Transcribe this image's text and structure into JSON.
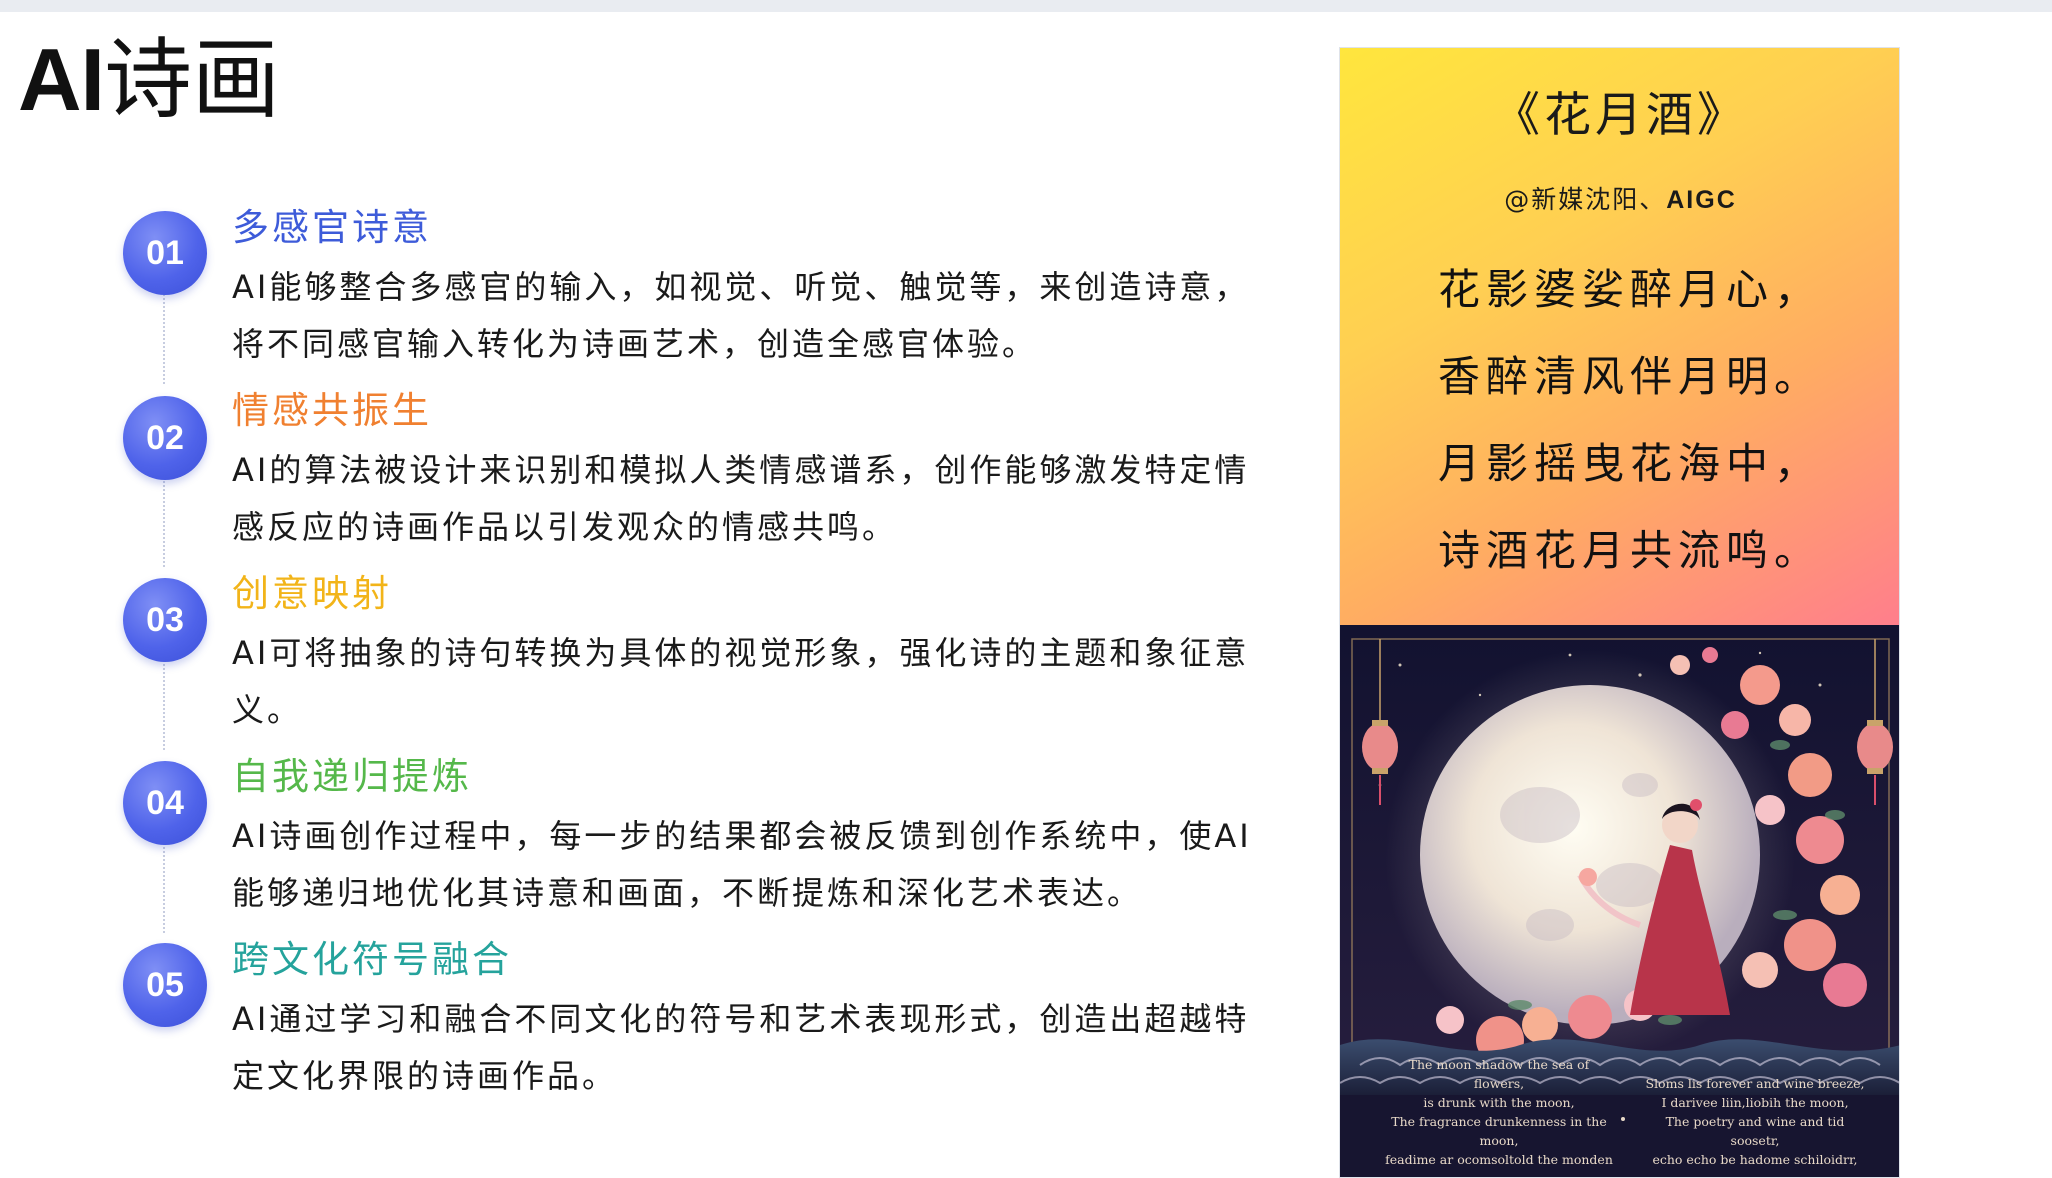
{
  "title": {
    "latin": "AI",
    "cjk": "诗画"
  },
  "colors": {
    "badge": "#4f63ea",
    "item_titles": [
      "#3d5bd9",
      "#f08030",
      "#f2b419",
      "#55b84a",
      "#25a39c"
    ],
    "poster_gradient": [
      "#ffe63d",
      "#ffac62",
      "#ff7e8c"
    ]
  },
  "items": [
    {
      "number": "01",
      "title": "多感官诗意",
      "body": "AI能够整合多感官的输入，如视觉、听觉、触觉等，来创造诗意，将不同感官输入转化为诗画艺术，创造全感官体验。"
    },
    {
      "number": "02",
      "title": "情感共振生",
      "body": "AI的算法被设计来识别和模拟人类情感谱系，创作能够激发特定情感反应的诗画作品以引发观众的情感共鸣。"
    },
    {
      "number": "03",
      "title": "创意映射",
      "body": "AI可将抽象的诗句转换为具体的视觉形象，强化诗的主题和象征意义。"
    },
    {
      "number": "04",
      "title": "自我递归提炼",
      "body": "AI诗画创作过程中，每一步的结果都会被反馈到创作系统中，使AI能够递归地优化其诗意和画面，不断提炼和深化艺术表达。"
    },
    {
      "number": "05",
      "title": "跨文化符号融合",
      "body": "AI通过学习和融合不同文化的符号和艺术表现形式，创造出超越特定文化界限的诗画作品。"
    }
  ],
  "poster": {
    "title": "《花月酒》",
    "author_prefix": "@新媒沈阳、",
    "author_suffix": "AIGC",
    "lines": [
      "花影婆娑醉月心，",
      "香醉清风伴月明。",
      "月影摇曳花海中，",
      "诗酒花月共流鸣。"
    ],
    "image_icon": "moon-flowers-lady-painting",
    "caption_left": [
      "The moon shadow the sea of flowers,",
      "is drunk with the moon,",
      "The fragrance drunkenness in the moon,",
      "feadime ar ocomsoltold the monden"
    ],
    "caption_right": [
      "Sloms lis forever and wine breeze,",
      "I darivee liin,liobih the moon,",
      "The poetry and wine and tid soosetr,",
      "echo echo be hadome schiloidrr,"
    ]
  }
}
